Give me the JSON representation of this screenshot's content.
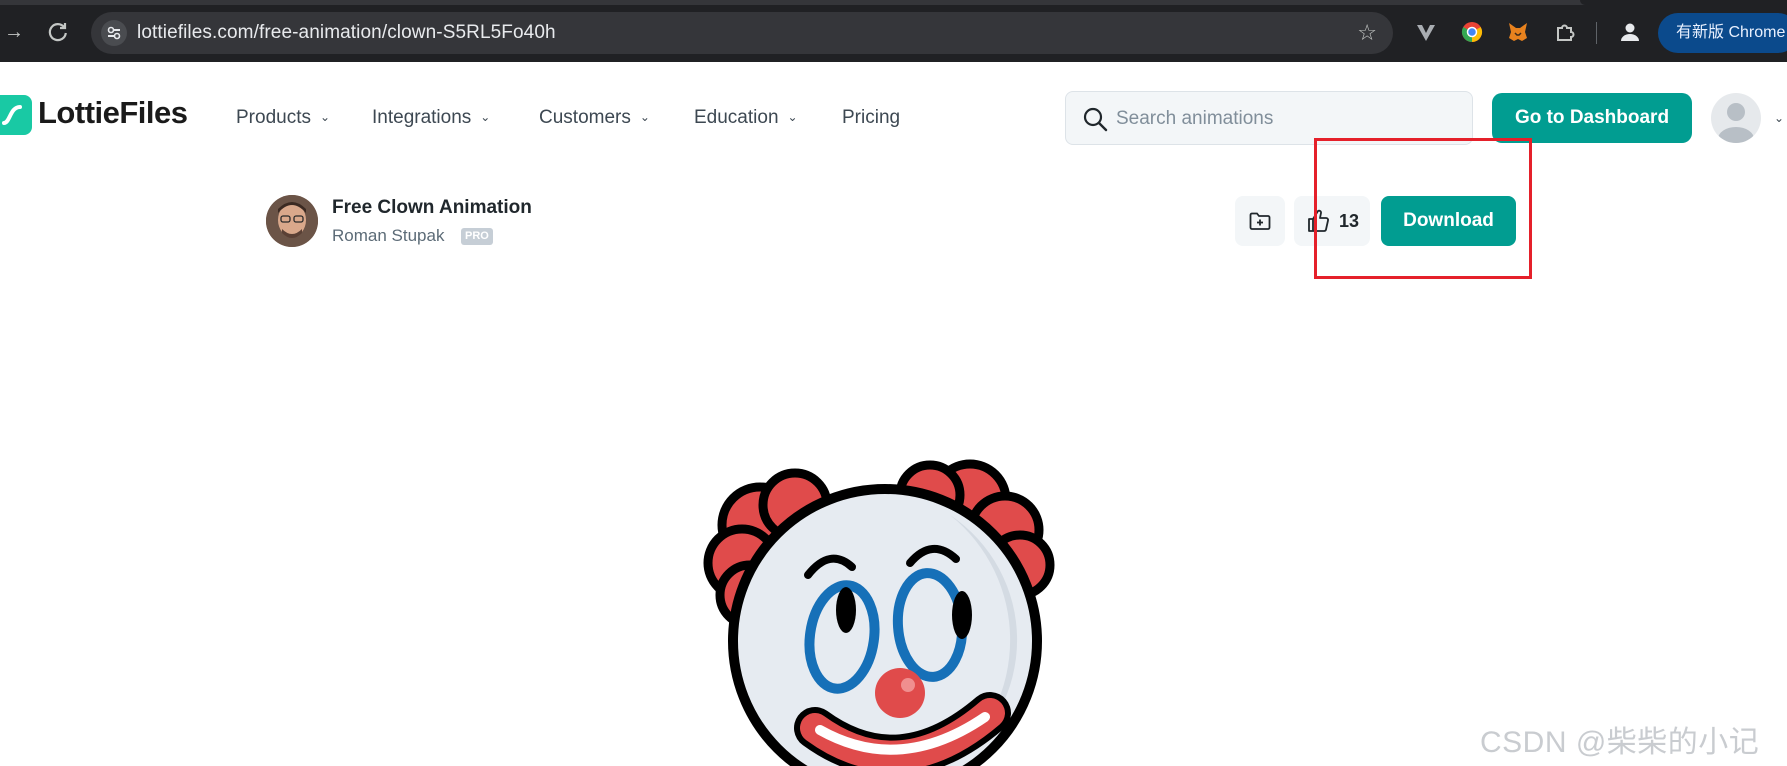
{
  "browser": {
    "url": "lottiefiles.com/free-animation/clown-S5RL5Fo40h",
    "update_label": "有新版 Chrome",
    "icons": [
      "forward-icon",
      "reload-icon",
      "site-info-icon",
      "bookmark-star-icon",
      "vivaldi-extension-icon",
      "chrome-extension-icon",
      "metamask-extension-icon",
      "extensions-puzzle-icon",
      "profile-icon"
    ]
  },
  "header": {
    "logo_text": "LottieFiles",
    "nav": [
      {
        "label": "Products",
        "has_dropdown": true
      },
      {
        "label": "Integrations",
        "has_dropdown": true
      },
      {
        "label": "Customers",
        "has_dropdown": true
      },
      {
        "label": "Education",
        "has_dropdown": true
      },
      {
        "label": "Pricing",
        "has_dropdown": false
      }
    ],
    "search_placeholder": "Search animations",
    "dashboard_label": "Go to Dashboard"
  },
  "animation": {
    "title": "Free Clown Animation",
    "author": "Roman Stupak",
    "badge": "PRO",
    "likes": "13",
    "download_label": "Download"
  },
  "colors": {
    "brand_teal": "#019d91",
    "logo_green": "#19c9a4",
    "highlight_red": "#e5202a",
    "clown_hair": "#e04b4b",
    "clown_eye_ring": "#1670b8"
  },
  "watermark": "CSDN @柴柴的小记"
}
